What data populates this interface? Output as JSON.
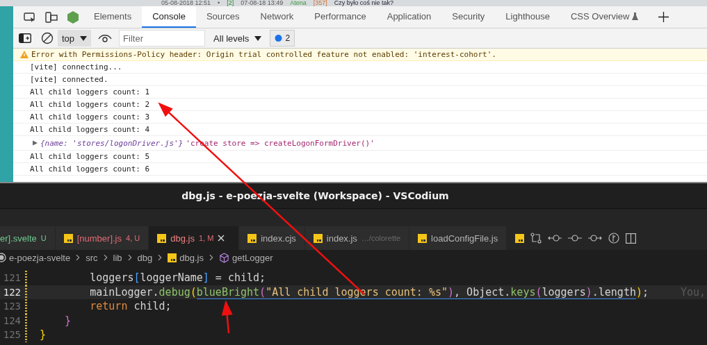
{
  "background_page": [
    {
      "text": "05-08-2018 12:51",
      "kind": "date"
    },
    {
      "text": "•",
      "kind": "date"
    },
    {
      "text": "[2]",
      "kind": "index"
    },
    {
      "text": "07-08-18 13:49",
      "kind": "date"
    },
    {
      "text": "Atena",
      "kind": "name"
    },
    {
      "text": "[357]",
      "kind": "count"
    },
    {
      "text": "Czy było coś nie tak?",
      "kind": "title"
    }
  ],
  "devtools": {
    "tabs": [
      {
        "label": "Elements",
        "selected": false
      },
      {
        "label": "Console",
        "selected": true
      },
      {
        "label": "Sources",
        "selected": false
      },
      {
        "label": "Network",
        "selected": false
      },
      {
        "label": "Performance",
        "selected": false
      },
      {
        "label": "Application",
        "selected": false
      },
      {
        "label": "Security",
        "selected": false
      },
      {
        "label": "Lighthouse",
        "selected": false
      },
      {
        "label": "CSS Overview",
        "selected": false,
        "experimental": true
      }
    ],
    "context": "top",
    "filter": {
      "placeholder": "Filter"
    },
    "levels": "All levels",
    "issues": "2",
    "messages": [
      {
        "kind": "warning",
        "text": "Error with Permissions-Policy header: Origin trial controlled feature not enabled: 'interest-cohort'."
      },
      {
        "kind": "log",
        "text": "[vite] connecting..."
      },
      {
        "kind": "log",
        "text": "[vite] connected."
      },
      {
        "kind": "log",
        "text": "All child loggers count: 1"
      },
      {
        "kind": "log",
        "text": "All child loggers count: 2"
      },
      {
        "kind": "log",
        "text": "All child loggers count: 3"
      },
      {
        "kind": "log",
        "text": "All child loggers count: 4"
      },
      {
        "kind": "object",
        "object": "{name: 'stores/logonDriver.js'}",
        "text": "'create store => createLogonFormDriver()'",
        "expanded": false
      },
      {
        "kind": "log",
        "text": "All child loggers count: 5"
      },
      {
        "kind": "log",
        "text": "All child loggers count: 6"
      }
    ]
  },
  "editor": {
    "title": "dbg.js - e-poezja-svelte (Workspace) - VSCodium",
    "tabs": [
      {
        "label": "er].svelte",
        "badge": "U",
        "kind": "untracked",
        "selected": false
      },
      {
        "label": "[number].js",
        "badge": "4, U",
        "kind": "problem",
        "selected": false
      },
      {
        "label": "dbg.js",
        "badge": "1, M",
        "kind": "problem",
        "selected": true
      },
      {
        "label": "index.cjs",
        "kind": "plain",
        "selected": false
      },
      {
        "label": "index.js",
        "detail": "…/colorette",
        "kind": "plain",
        "selected": false
      },
      {
        "label": "loadConfigFile.js",
        "kind": "plain",
        "selected": false
      }
    ],
    "breadcrumbs": [
      {
        "label": "e-poezja-svelte",
        "kind": "folder"
      },
      {
        "label": "src",
        "kind": "folder"
      },
      {
        "label": "lib",
        "kind": "folder"
      },
      {
        "label": "dbg",
        "kind": "folder"
      },
      {
        "label": "dbg.js",
        "kind": "file"
      },
      {
        "label": "getLogger",
        "kind": "symbol"
      }
    ],
    "lines": [
      {
        "number": "121",
        "selected": false,
        "tokens": [
          {
            "text": "        loggers",
            "kind": "plain"
          },
          {
            "text": "[",
            "kind": "bracket2"
          },
          {
            "text": "loggerName",
            "kind": "plain"
          },
          {
            "text": "]",
            "kind": "bracket2"
          },
          {
            "text": " = child;",
            "kind": "plain"
          }
        ]
      },
      {
        "number": "122",
        "selected": true,
        "blame": "You,",
        "tokens": [
          {
            "text": "        mainLogger.",
            "kind": "plain"
          },
          {
            "text": "debug",
            "kind": "func"
          },
          {
            "text": "(",
            "kind": "bracket1"
          },
          {
            "text": "blueBright",
            "kind": "func"
          },
          {
            "text": "(",
            "kind": "bracket3"
          },
          {
            "text": "\"All child loggers count: %s\"",
            "kind": "string"
          },
          {
            "text": ")",
            "kind": "bracket3"
          },
          {
            "text": ", Object.",
            "kind": "plain"
          },
          {
            "text": "keys",
            "kind": "func"
          },
          {
            "text": "(",
            "kind": "bracket3"
          },
          {
            "text": "loggers",
            "kind": "plain"
          },
          {
            "text": ")",
            "kind": "bracket3"
          },
          {
            "text": ".length",
            "kind": "plain"
          },
          {
            "text": ")",
            "kind": "bracket1"
          },
          {
            "text": ";",
            "kind": "plain"
          }
        ]
      },
      {
        "number": "123",
        "selected": false,
        "tokens": [
          {
            "text": "        return",
            "kind": "keyword"
          },
          {
            "text": " child;",
            "kind": "plain"
          }
        ]
      },
      {
        "number": "124",
        "selected": false,
        "tokens": [
          {
            "text": "    }",
            "kind": "bracket3"
          }
        ]
      },
      {
        "number": "125",
        "selected": false,
        "tokens": [
          {
            "text": "}",
            "kind": "bracket1"
          }
        ]
      }
    ]
  }
}
